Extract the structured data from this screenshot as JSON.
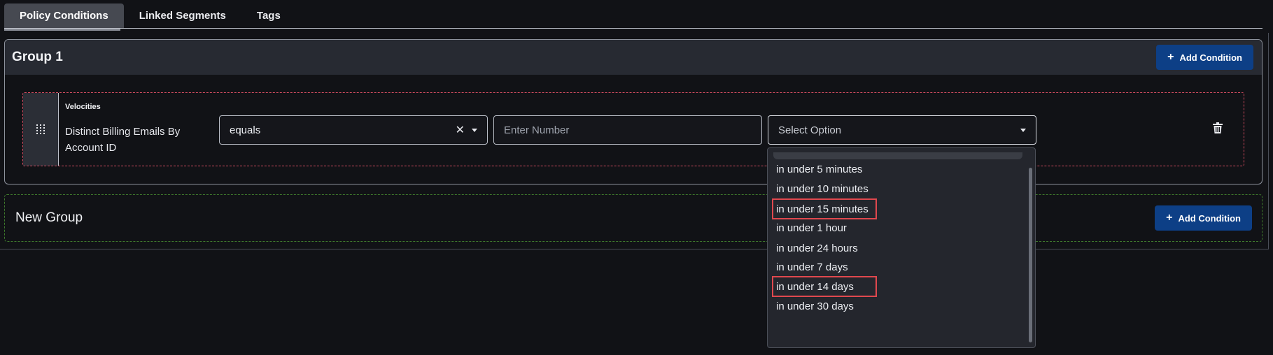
{
  "tabs": [
    {
      "label": "Policy Conditions",
      "active": true
    },
    {
      "label": "Linked Segments",
      "active": false
    },
    {
      "label": "Tags",
      "active": false
    }
  ],
  "group1": {
    "title": "Group 1",
    "add_condition_label": "Add Condition",
    "condition": {
      "type_label": "Velocities",
      "name": "Distinct Billing Emails By Account ID",
      "operator_value": "equals",
      "number_placeholder": "Enter Number",
      "select_placeholder": "Select Option"
    }
  },
  "new_group": {
    "title": "New Group",
    "add_condition_label": "Add Condition"
  },
  "dropdown": {
    "options": [
      {
        "label": "in under 5 minutes",
        "highlighted": false
      },
      {
        "label": "in under 10 minutes",
        "highlighted": false
      },
      {
        "label": "in under 15 minutes",
        "highlighted": true
      },
      {
        "label": "in under 1 hour",
        "highlighted": false
      },
      {
        "label": "in under 24 hours",
        "highlighted": false
      },
      {
        "label": "in under 7 days",
        "highlighted": false
      },
      {
        "label": "in under 14 days",
        "highlighted": true
      },
      {
        "label": "in under 30 days",
        "highlighted": false
      }
    ]
  },
  "icons": {
    "drag": "drag-handle-icon",
    "clear": "close-icon",
    "caret": "chevron-down-icon",
    "trash": "trash-icon",
    "plus": "plus-icon"
  },
  "colors": {
    "accent_button": "#0d3f86",
    "highlight_border": "#e0484e",
    "condition_border": "#d14b5f",
    "new_group_border": "#3f7a2c"
  }
}
